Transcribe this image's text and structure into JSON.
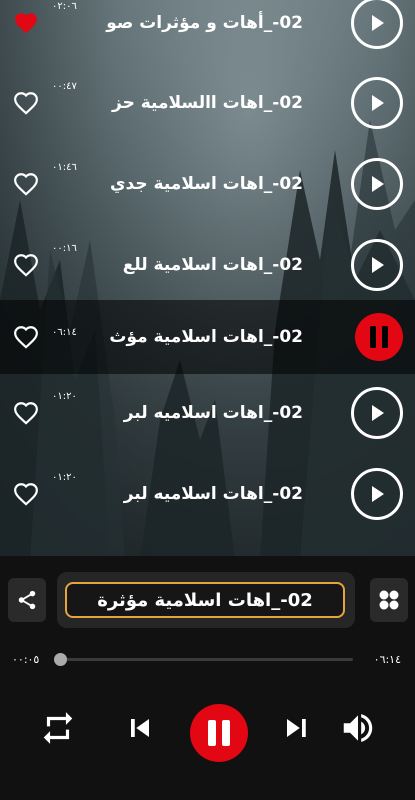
{
  "tracks": [
    {
      "title": "02-_أهات و مؤثرات صو",
      "duration": "٠٢:٠٦",
      "liked": true,
      "state": "play"
    },
    {
      "title": "02-_اهات االسلامية حز",
      "duration": "٠٠:٤٧",
      "liked": false,
      "state": "play"
    },
    {
      "title": "02-_اهات اسلامية جدي",
      "duration": "٠١:٤٦",
      "liked": false,
      "state": "play"
    },
    {
      "title": "02-_اهات اسلامية للع",
      "duration": "٠٠:١٦",
      "liked": false,
      "state": "play"
    },
    {
      "title": "02-_اهات اسلامية مؤث",
      "duration": "٠٦:١٤",
      "liked": false,
      "state": "pause"
    },
    {
      "title": "02-_اهات اسلاميه لبر",
      "duration": "٠١:٢٠",
      "liked": false,
      "state": "play"
    },
    {
      "title": "02-_اهات اسلاميه لبر",
      "duration": "٠١:٢٠",
      "liked": false,
      "state": "play"
    }
  ],
  "player": {
    "now_playing_title": "02-_اهات اسلامية مؤثرة",
    "elapsed": "٠٠:٠٥",
    "total": "٠٦:١٤",
    "progress": 0.013
  },
  "icons": {
    "share": "share-icon",
    "grid": "grid-icon",
    "repeat": "repeat-icon",
    "previous": "skip-previous-icon",
    "pause": "pause-icon",
    "next": "skip-next-icon",
    "volume": "volume-icon"
  },
  "colors": {
    "accent_red": "#e30613",
    "title_border": "#e6a53a"
  }
}
